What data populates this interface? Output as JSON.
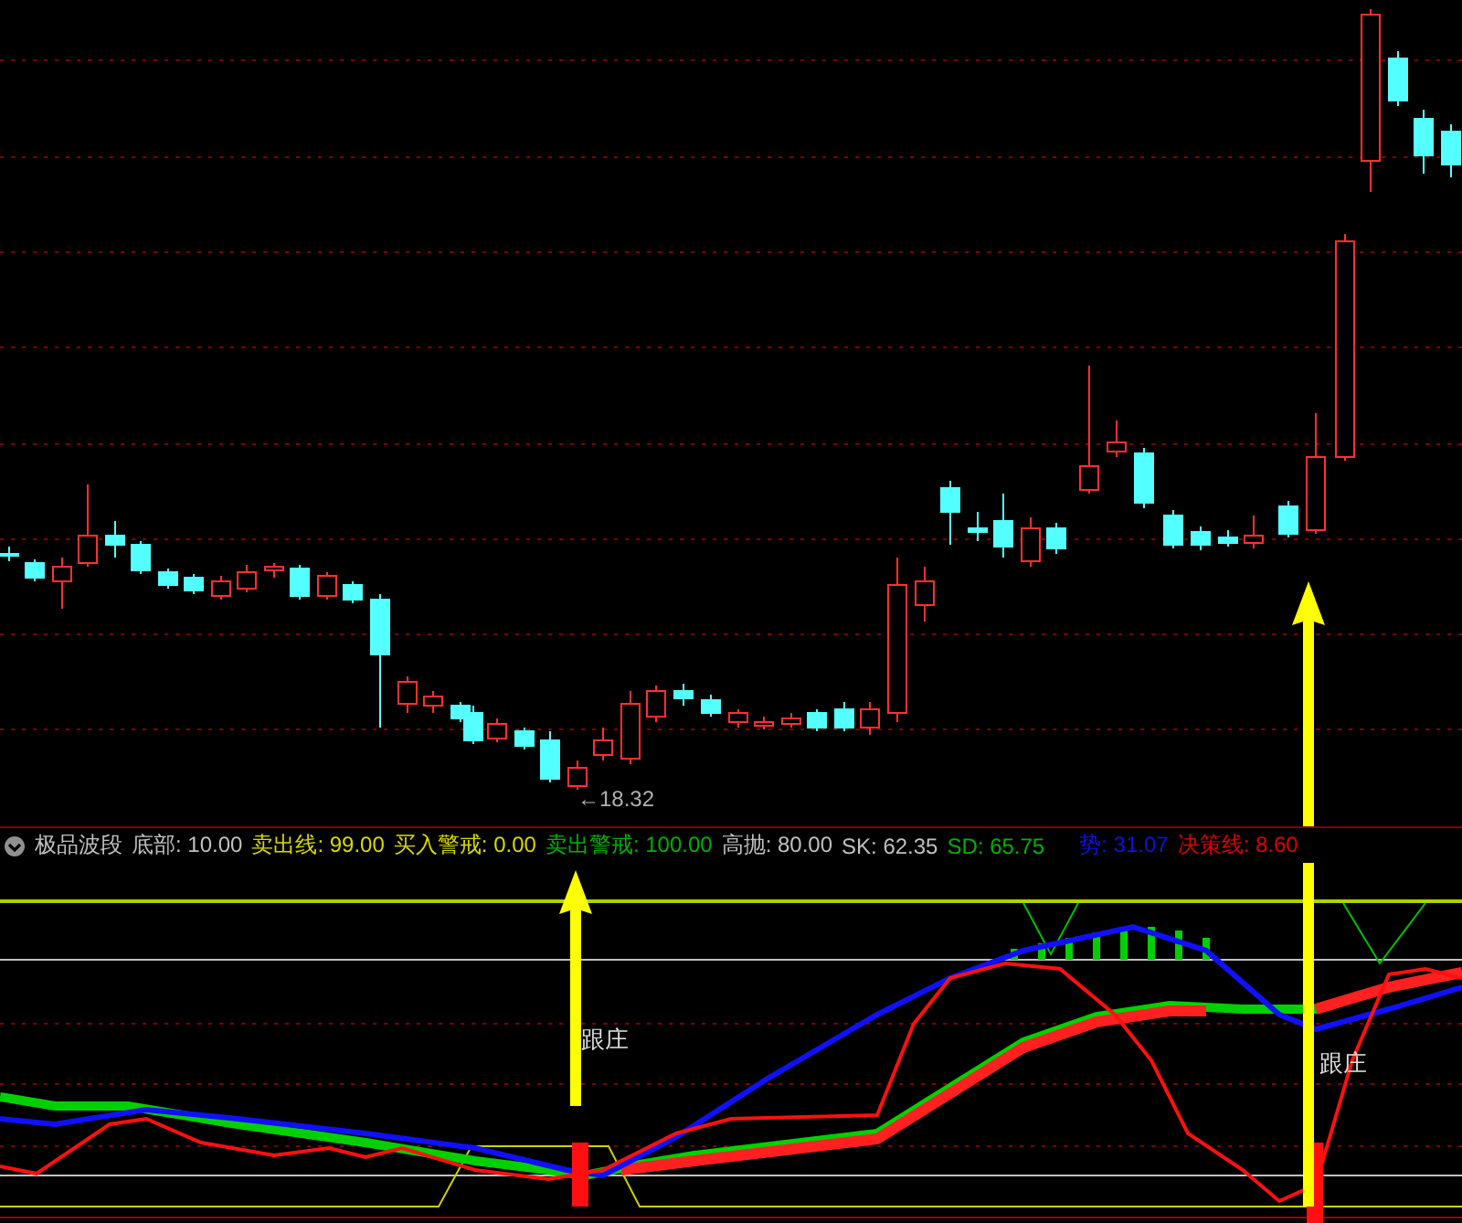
{
  "indicator": {
    "name": "极品波段",
    "legend": [
      {
        "text": "底部: 10.00",
        "color": "#c0c0c0"
      },
      {
        "text": "卖出线: 99.00",
        "color": "#d8d800"
      },
      {
        "text": "买入警戒: 0.00",
        "color": "#d8d800"
      },
      {
        "text": "卖出警戒: 100.00",
        "color": "#00b000"
      },
      {
        "text": "高抛: 80.00",
        "color": "#c0c0c0"
      },
      {
        "text": "SK: 62.35",
        "color": "#c0c0c0"
      },
      {
        "text": "SD: 65.75",
        "color": "#00b000"
      },
      {
        "text": "势: 31.07",
        "color": "#1010e0"
      },
      {
        "text": "决策线: 8.60",
        "color": "#e00000"
      }
    ]
  },
  "price_label": "←18.32",
  "signal_labels": [
    "跟庄",
    "跟庄"
  ]
}
